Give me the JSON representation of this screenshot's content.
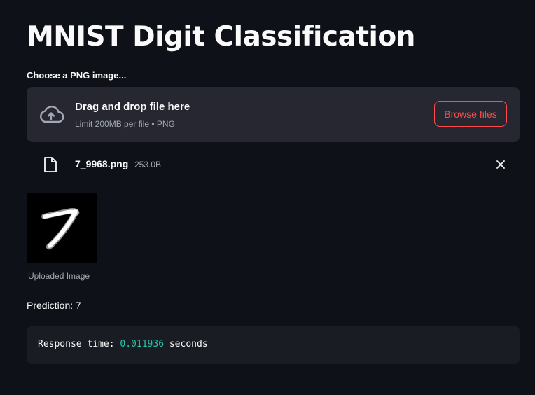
{
  "page": {
    "title": "MNIST Digit Classification"
  },
  "uploader": {
    "label": "Choose a PNG image...",
    "drop_text": "Drag and drop file here",
    "limit_text": "Limit 200MB per file • PNG",
    "browse_label": "Browse files",
    "icon": "cloud-upload-icon"
  },
  "uploaded_file": {
    "name": "7_9968.png",
    "size": "253.0B",
    "icon": "file-icon",
    "remove_icon": "close-icon"
  },
  "image": {
    "caption": "Uploaded Image"
  },
  "result": {
    "prediction": "Prediction: 7",
    "response_prefix": "Response time: ",
    "response_value": "0.011936",
    "response_suffix": " seconds"
  },
  "colors": {
    "background": "#0e1117",
    "panel": "#262730",
    "accent": "#ff4b4b",
    "code_number": "#2bc4a8"
  }
}
